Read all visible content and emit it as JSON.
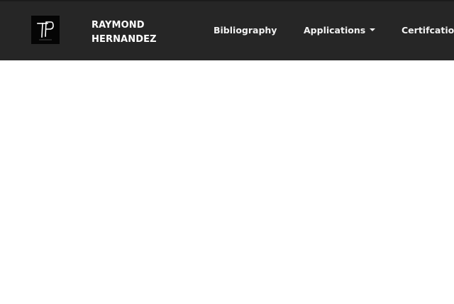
{
  "header": {
    "logo_icon": "rh-monogram-logo",
    "brand_line1": "RAYMOND",
    "brand_line2": "HERNANDEZ",
    "background": "#262626"
  },
  "nav": {
    "bibliography": "Bibliography",
    "applications": "Applications",
    "certifications": "Certifcations"
  }
}
